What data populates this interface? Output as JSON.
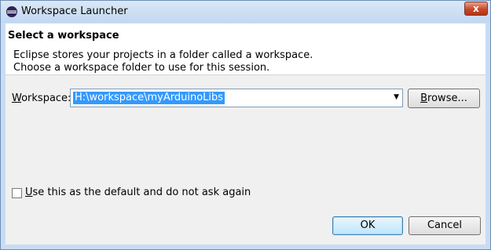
{
  "window": {
    "title": "Workspace Launcher",
    "close_glyph": "x"
  },
  "header": {
    "title": "Select a workspace",
    "desc_line1": "Eclipse stores your projects in a folder called a workspace.",
    "desc_line2": "Choose a workspace folder to use for this session."
  },
  "form": {
    "workspace_label_mnemonic": "W",
    "workspace_label_rest": "orkspace:",
    "workspace_value": "H:\\workspace\\myArduinoLibs",
    "dropdown_arrow": "▼",
    "browse_mnemonic": "B",
    "browse_rest": "rowse...",
    "default_checkbox_mnemonic": "U",
    "default_checkbox_rest": "se this as the default and do not ask again",
    "default_checked": false
  },
  "buttons": {
    "ok": "OK",
    "cancel": "Cancel"
  },
  "icons": {
    "app": "eclipse-icon",
    "close": "close-icon",
    "dropdown": "chevron-down-icon"
  }
}
